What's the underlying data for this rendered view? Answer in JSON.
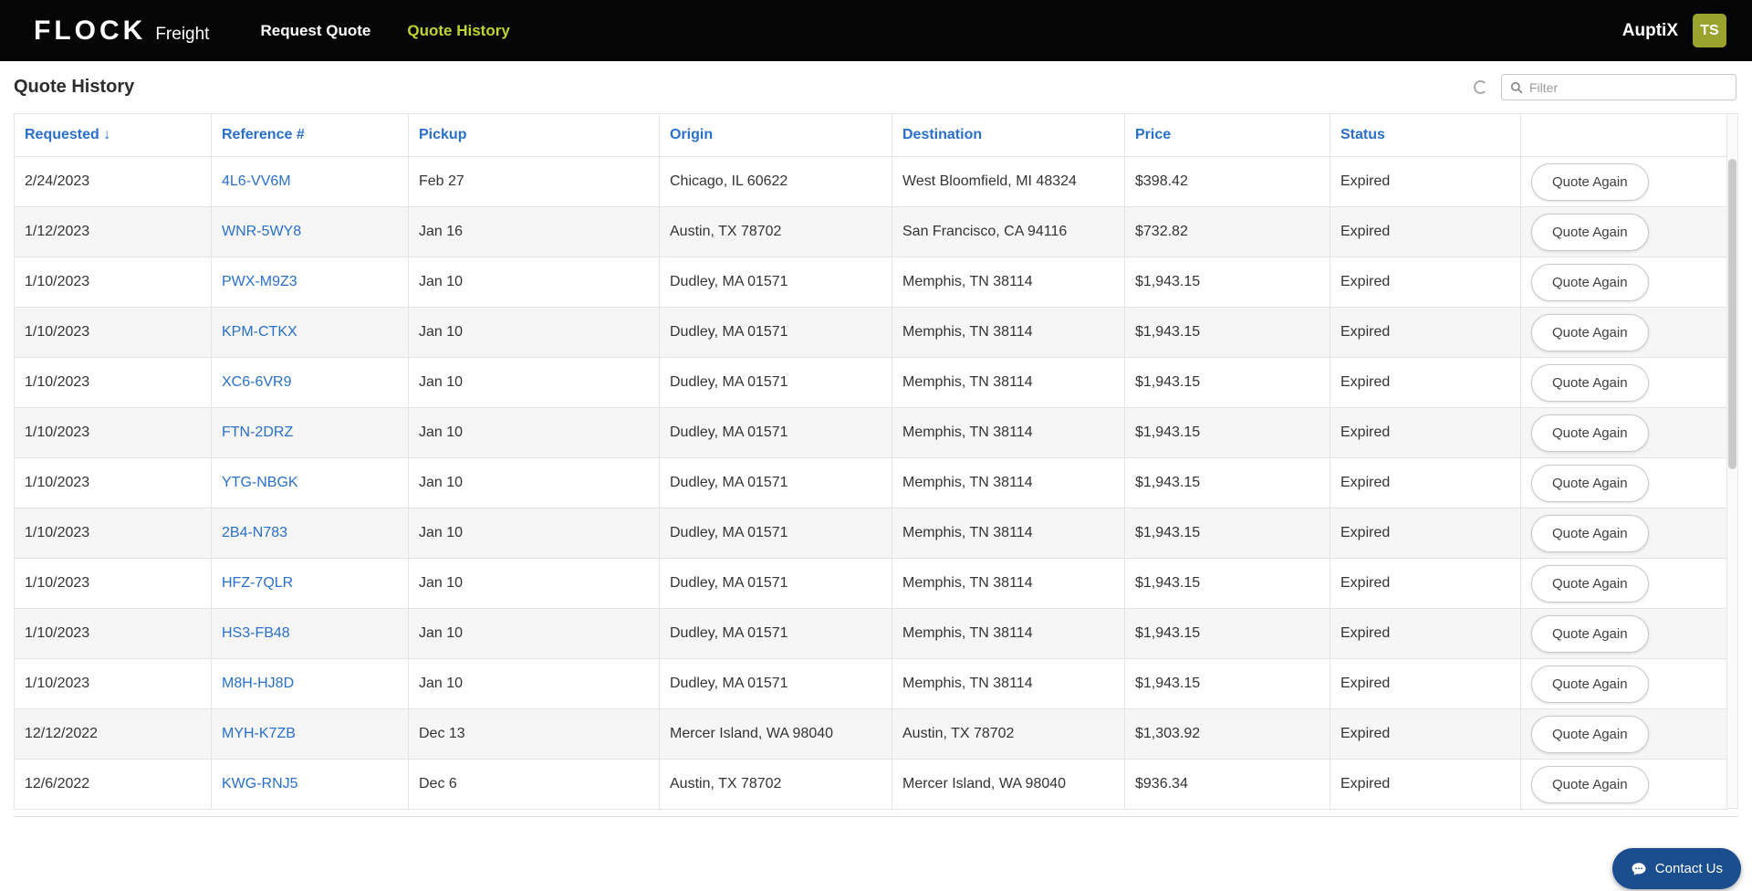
{
  "colors": {
    "brand_green": "#bfd42f",
    "avatar_olive": "#9aa32e",
    "link_blue": "#2a6fc9",
    "chat_blue": "#1b4e8f",
    "navbar_bg": "#050505"
  },
  "navbar": {
    "brand": {
      "name": "FLOCK",
      "suffix": "Freight"
    },
    "items": [
      {
        "label": "Request Quote",
        "active": false
      },
      {
        "label": "Quote History",
        "active": true
      }
    ],
    "product": "AuptiX",
    "avatar_initials": "TS"
  },
  "page": {
    "title": "Quote History"
  },
  "filter": {
    "placeholder": "Filter"
  },
  "table": {
    "action_label": "Quote Again",
    "columns": [
      {
        "label": "Requested",
        "sort_indicator": "↓"
      },
      {
        "label": "Reference #"
      },
      {
        "label": "Pickup"
      },
      {
        "label": "Origin"
      },
      {
        "label": "Destination"
      },
      {
        "label": "Price"
      },
      {
        "label": "Status"
      },
      {
        "label": ""
      }
    ],
    "rows": [
      {
        "requested": "2/24/2023",
        "reference": "4L6-VV6M",
        "pickup": "Feb 27",
        "origin": "Chicago, IL 60622",
        "destination": "West Bloomfield, MI 48324",
        "price": "$398.42",
        "status": "Expired"
      },
      {
        "requested": "1/12/2023",
        "reference": "WNR-5WY8",
        "pickup": "Jan 16",
        "origin": "Austin, TX 78702",
        "destination": "San Francisco, CA 94116",
        "price": "$732.82",
        "status": "Expired"
      },
      {
        "requested": "1/10/2023",
        "reference": "PWX-M9Z3",
        "pickup": "Jan 10",
        "origin": "Dudley, MA 01571",
        "destination": "Memphis, TN 38114",
        "price": "$1,943.15",
        "status": "Expired"
      },
      {
        "requested": "1/10/2023",
        "reference": "KPM-CTKX",
        "pickup": "Jan 10",
        "origin": "Dudley, MA 01571",
        "destination": "Memphis, TN 38114",
        "price": "$1,943.15",
        "status": "Expired"
      },
      {
        "requested": "1/10/2023",
        "reference": "XC6-6VR9",
        "pickup": "Jan 10",
        "origin": "Dudley, MA 01571",
        "destination": "Memphis, TN 38114",
        "price": "$1,943.15",
        "status": "Expired"
      },
      {
        "requested": "1/10/2023",
        "reference": "FTN-2DRZ",
        "pickup": "Jan 10",
        "origin": "Dudley, MA 01571",
        "destination": "Memphis, TN 38114",
        "price": "$1,943.15",
        "status": "Expired"
      },
      {
        "requested": "1/10/2023",
        "reference": "YTG-NBGK",
        "pickup": "Jan 10",
        "origin": "Dudley, MA 01571",
        "destination": "Memphis, TN 38114",
        "price": "$1,943.15",
        "status": "Expired"
      },
      {
        "requested": "1/10/2023",
        "reference": "2B4-N783",
        "pickup": "Jan 10",
        "origin": "Dudley, MA 01571",
        "destination": "Memphis, TN 38114",
        "price": "$1,943.15",
        "status": "Expired"
      },
      {
        "requested": "1/10/2023",
        "reference": "HFZ-7QLR",
        "pickup": "Jan 10",
        "origin": "Dudley, MA 01571",
        "destination": "Memphis, TN 38114",
        "price": "$1,943.15",
        "status": "Expired"
      },
      {
        "requested": "1/10/2023",
        "reference": "HS3-FB48",
        "pickup": "Jan 10",
        "origin": "Dudley, MA 01571",
        "destination": "Memphis, TN 38114",
        "price": "$1,943.15",
        "status": "Expired"
      },
      {
        "requested": "1/10/2023",
        "reference": "M8H-HJ8D",
        "pickup": "Jan 10",
        "origin": "Dudley, MA 01571",
        "destination": "Memphis, TN 38114",
        "price": "$1,943.15",
        "status": "Expired"
      },
      {
        "requested": "12/12/2022",
        "reference": "MYH-K7ZB",
        "pickup": "Dec 13",
        "origin": "Mercer Island, WA 98040",
        "destination": "Austin, TX 78702",
        "price": "$1,303.92",
        "status": "Expired"
      },
      {
        "requested": "12/6/2022",
        "reference": "KWG-RNJ5",
        "pickup": "Dec 6",
        "origin": "Austin, TX 78702",
        "destination": "Mercer Island, WA 98040",
        "price": "$936.34",
        "status": "Expired"
      }
    ]
  },
  "chat": {
    "label": "Contact Us"
  }
}
